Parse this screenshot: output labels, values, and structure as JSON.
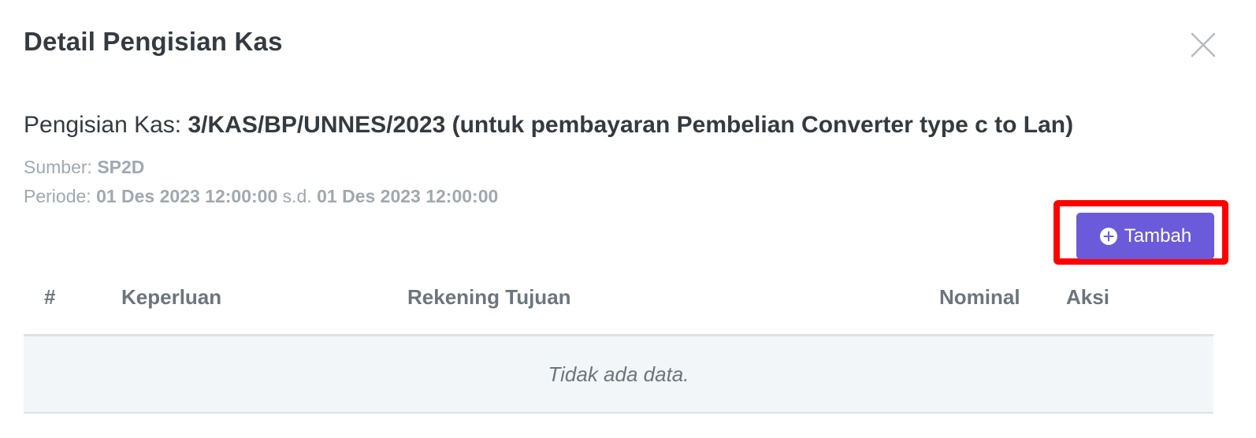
{
  "modal": {
    "title": "Detail Pengisian Kas",
    "close_icon": "close-icon"
  },
  "info": {
    "title_label": "Pengisian Kas: ",
    "title_value": "3/KAS/BP/UNNES/2023 (untuk pembayaran Pembelian Converter type c to Lan)",
    "sumber_label": "Sumber: ",
    "sumber_value": "SP2D",
    "periode_label": "Periode: ",
    "periode_start": "01 Des 2023 12:00:00",
    "periode_sep": " s.d. ",
    "periode_end": "01 Des 2023 12:00:00"
  },
  "actions": {
    "add_label": "Tambah",
    "add_icon": "plus-circle-icon",
    "highlight_color": "#ff0000",
    "button_color": "#6b5bdb"
  },
  "table": {
    "columns": [
      "#",
      "Keperluan",
      "Rekening Tujuan",
      "Nominal",
      "Aksi"
    ],
    "rows": [],
    "empty_message": "Tidak ada data."
  }
}
